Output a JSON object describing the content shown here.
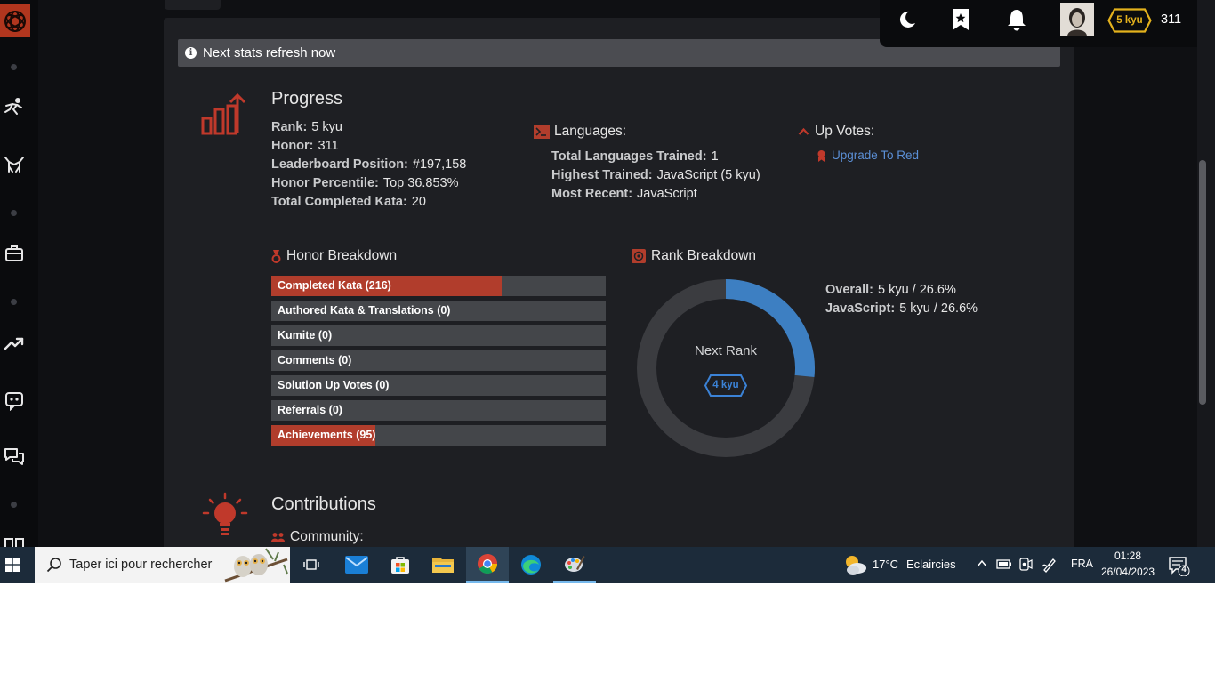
{
  "notice": {
    "text": "Next stats refresh now",
    "icon": "info-icon"
  },
  "progress": {
    "title": "Progress",
    "stats": [
      {
        "label": "Rank:",
        "value": "5 kyu"
      },
      {
        "label": "Honor:",
        "value": "311"
      },
      {
        "label": "Leaderboard Position:",
        "value": "#197,158"
      },
      {
        "label": "Honor Percentile:",
        "value": "Top 36.853%"
      },
      {
        "label": "Total Completed Kata:",
        "value": "20"
      }
    ]
  },
  "languages": {
    "title": "Languages:",
    "stats": [
      {
        "label": "Total Languages Trained:",
        "value": "1"
      },
      {
        "label": "Highest Trained:",
        "value": "JavaScript (5 kyu)"
      },
      {
        "label": "Most Recent:",
        "value": "JavaScript"
      }
    ]
  },
  "upvotes": {
    "title": "Up Votes:",
    "link": "Upgrade To Red"
  },
  "honor_breakdown": {
    "title": "Honor Breakdown",
    "bars": [
      {
        "label": "Completed Kata (216)",
        "fill": 0.69
      },
      {
        "label": "Authored Kata & Translations (0)",
        "fill": 0
      },
      {
        "label": "Kumite (0)",
        "fill": 0
      },
      {
        "label": "Comments (0)",
        "fill": 0
      },
      {
        "label": "Solution Up Votes (0)",
        "fill": 0
      },
      {
        "label": "Referrals (0)",
        "fill": 0
      },
      {
        "label": "Achievements (95)",
        "fill": 0.31
      }
    ]
  },
  "rank_breakdown": {
    "title": "Rank Breakdown",
    "center_label": "Next Rank",
    "next_rank": "4 kyu",
    "progress": 0.266,
    "stats": [
      {
        "label": "Overall:",
        "value": "5 kyu / 26.6%"
      },
      {
        "label": "JavaScript:",
        "value": "5 kyu / 26.6%"
      }
    ]
  },
  "contributions": {
    "title": "Contributions",
    "community_label": "Community:"
  },
  "user_panel": {
    "rank_badge": "5 kyu",
    "honor": "311"
  },
  "taskbar": {
    "search_placeholder": "Taper ici pour rechercher",
    "weather_temp": "17°C",
    "weather_text": "Eclaircies",
    "language": "FRA",
    "time": "01:28",
    "date": "26/04/2023",
    "notification_count": "4"
  },
  "colors": {
    "accent": "#b13d2c",
    "link": "#5b8fd6",
    "rank_blue": "#3b82d6",
    "badge_yellow": "#e4b21d"
  }
}
